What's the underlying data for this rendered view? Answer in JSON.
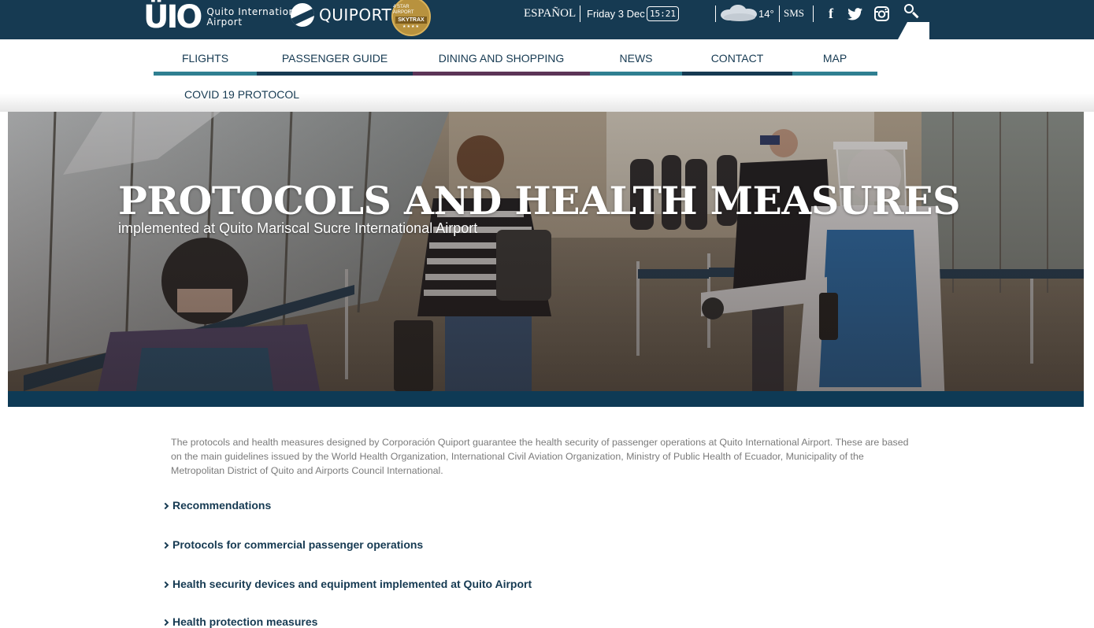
{
  "header": {
    "logo_mark": "ÜIO",
    "logo_text_line1": "Quito International",
    "logo_text_line2": "Airport",
    "quiport_text": "QUIPORT",
    "skytrax_top": "4 STAR AIRPORT",
    "skytrax_band": "SKYTRAX",
    "skytrax_stars": "★★★★",
    "language": "ESPAÑOL",
    "date": "Friday 3 Dec",
    "clock": "15:21",
    "temperature": "14°",
    "sms": "SMS",
    "social": [
      {
        "name": "facebook-icon",
        "glyph": "f"
      },
      {
        "name": "twitter-icon",
        "glyph": "🐦"
      },
      {
        "name": "instagram-icon",
        "glyph": "◘"
      }
    ]
  },
  "nav": {
    "items": [
      {
        "label": "FLIGHTS",
        "color": "#2f7f91"
      },
      {
        "label": "PASSENGER GUIDE",
        "color": "#163a52"
      },
      {
        "label": "DINING AND SHOPPING",
        "color": "#5c3457"
      },
      {
        "label": "NEWS",
        "color": "#2f7f91"
      },
      {
        "label": "CONTACT",
        "color": "#163a52"
      },
      {
        "label": "MAP",
        "color": "#2f7f91"
      }
    ],
    "second_row": {
      "label": "COVID 19 PROTOCOL"
    }
  },
  "hero": {
    "title": "PROTOCOLS AND HEALTH MEASURES",
    "subtitle": "implemented at Quito Mariscal Sucre International Airport"
  },
  "content": {
    "intro": "The protocols and health measures designed by Corporación Quiport guarantee the health security of passenger operations at Quito International Airport. These are based on the main guidelines issued by the World Health Organization, International Civil Aviation Organization, Ministry of Public Health of Ecuador, Municipality of the Metropolitan District of Quito and Airports Council International.",
    "sections": [
      {
        "label": "Recommendations"
      },
      {
        "label": "Protocols for commercial passenger operations"
      },
      {
        "label": "Health security devices and equipment implemented at Quito Airport"
      },
      {
        "label": "Health protection measures"
      }
    ]
  },
  "colors": {
    "primary": "#163a52",
    "teal": "#2f7f91",
    "purple": "#5c3457",
    "text_gray": "#7b7b7b"
  }
}
